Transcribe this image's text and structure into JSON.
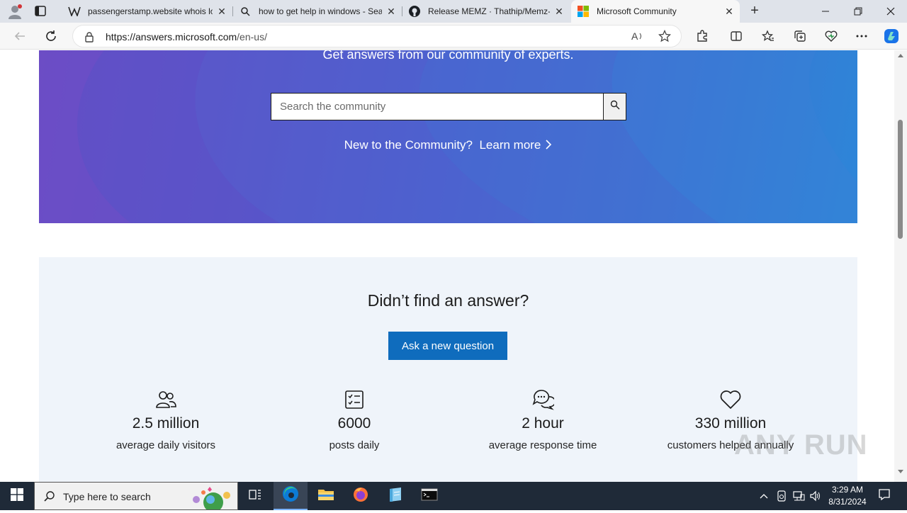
{
  "browser": {
    "tabs": [
      {
        "label": "passengerstamp.website whois lo",
        "icon": "wikipedia-w-icon",
        "active": false
      },
      {
        "label": "how to get help in windows - Sea",
        "icon": "search-icon",
        "active": false
      },
      {
        "label": "Release MEMZ · Thathip/Memz-D",
        "icon": "github-icon",
        "active": false
      },
      {
        "label": "Microsoft Community",
        "icon": "microsoft-logo-icon",
        "active": true
      }
    ],
    "url_host": "https://answers.microsoft.com",
    "url_path": "/en-us/"
  },
  "hero": {
    "tagline": "Get answers from our community of experts.",
    "search_placeholder": "Search the community",
    "new_to_community": "New to the Community?",
    "learn_more": "Learn more"
  },
  "panel": {
    "heading": "Didn’t find an answer?",
    "ask_button": "Ask a new question",
    "stats": [
      {
        "value": "2.5 million",
        "label": "average daily visitors",
        "icon": "people-icon"
      },
      {
        "value": "6000",
        "label": "posts daily",
        "icon": "checklist-icon"
      },
      {
        "value": "2 hour",
        "label": "average response time",
        "icon": "chat-bubbles-icon"
      },
      {
        "value": "330 million",
        "label": "customers helped annually",
        "icon": "heart-icon"
      }
    ]
  },
  "watermark": "ANY RUN",
  "taskbar": {
    "search_placeholder": "Type here to search",
    "time": "3:29 AM",
    "date": "8/31/2024"
  },
  "colors": {
    "hero_start": "#6a4cc4",
    "hero_end": "#2d86d8",
    "primary_button": "#0f6cbd",
    "panel_bg": "#eff4fa",
    "taskbar_bg": "#1f2a38"
  }
}
